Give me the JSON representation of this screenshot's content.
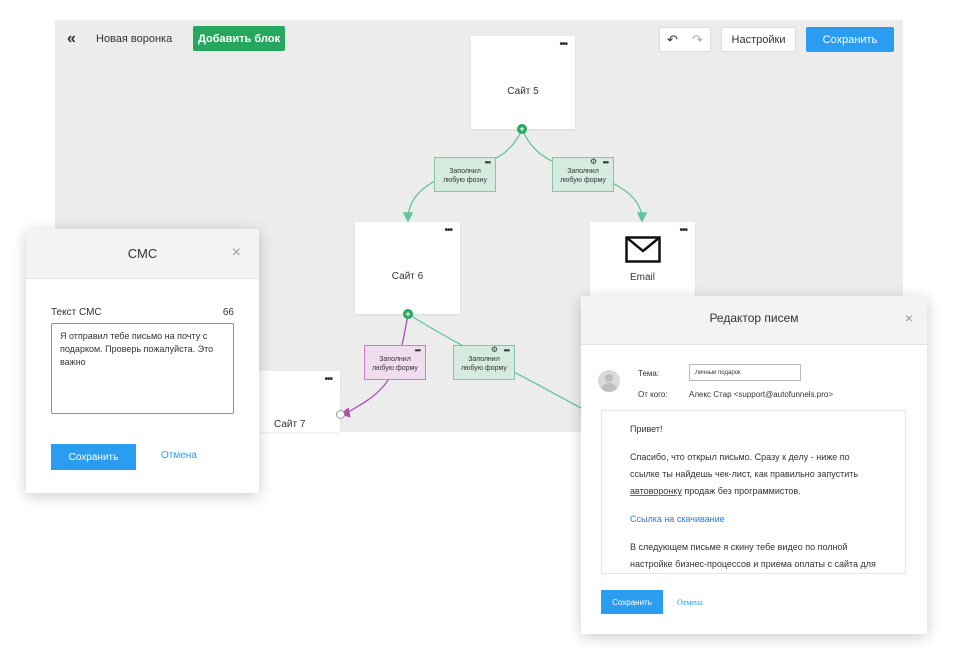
{
  "toolbar": {
    "back_icon": "«",
    "funnel_name": "Новая воронка",
    "add_block_label": "Добавить блок",
    "undo_icon": "↶",
    "redo_icon": "↷",
    "settings_label": "Настройки",
    "save_label": "Сохранить"
  },
  "blocks": {
    "site5": {
      "name": "Сайт 5",
      "menu": "•••"
    },
    "site6": {
      "name": "Сайт 6",
      "menu": "•••"
    },
    "email": {
      "name": "Email",
      "menu": "•••",
      "icon": "envelope-icon"
    },
    "site7": {
      "name": "Сайт 7",
      "menu": "•••"
    }
  },
  "conditions": [
    {
      "line1": "Заполнил",
      "line2": "любую фозну",
      "menu": "•••"
    },
    {
      "line1": "Заполнил",
      "line2": "любую форму",
      "menu": "•••",
      "gear": "⚙"
    },
    {
      "line1": "Заполнил",
      "line2": "любую форму",
      "menu": "•••"
    },
    {
      "line1": "Заполнил",
      "line2": "любую форму",
      "menu": "•••",
      "gear": "⚙"
    }
  ],
  "colors": {
    "accent_green": "#25a85e",
    "accent_blue": "#2b9df0",
    "connector_green": "#5fc79a",
    "connector_pink": "#b04db3"
  },
  "sms_modal": {
    "title": "СМС",
    "close_icon": "×",
    "text_label": "Текст СМС",
    "char_count": "66",
    "text_value": "Я отправил тебе письмо на почту с подарком. Проверь пожалуйста. Это важно",
    "save_label": "Сохранить",
    "cancel_label": "Отмена"
  },
  "mail_modal": {
    "title": "Редактор писем",
    "close_icon": "×",
    "subject_label": "Тема:",
    "subject_value": "Личный подарок",
    "from_label": "От кого:",
    "from_value": "Алекс Стар <support@autofunnels.pro>",
    "body": {
      "greeting": "Привет!",
      "para1_before": "Спасибо, что открыл письмо. Сразу к делу - ниже по ссылке ты найдешь чек-лист, как правильно запустить ",
      "para1_underlined": "автоворонку",
      "para1_after": " продаж без программистов.",
      "link": "Ссылка на скачивание",
      "para2": "В следующем письме я скину тебе видео по полной настройке бизнес-процессов и приема оплаты с сайта для"
    },
    "save_label": "Сохранить",
    "cancel_label": "Отмена"
  }
}
